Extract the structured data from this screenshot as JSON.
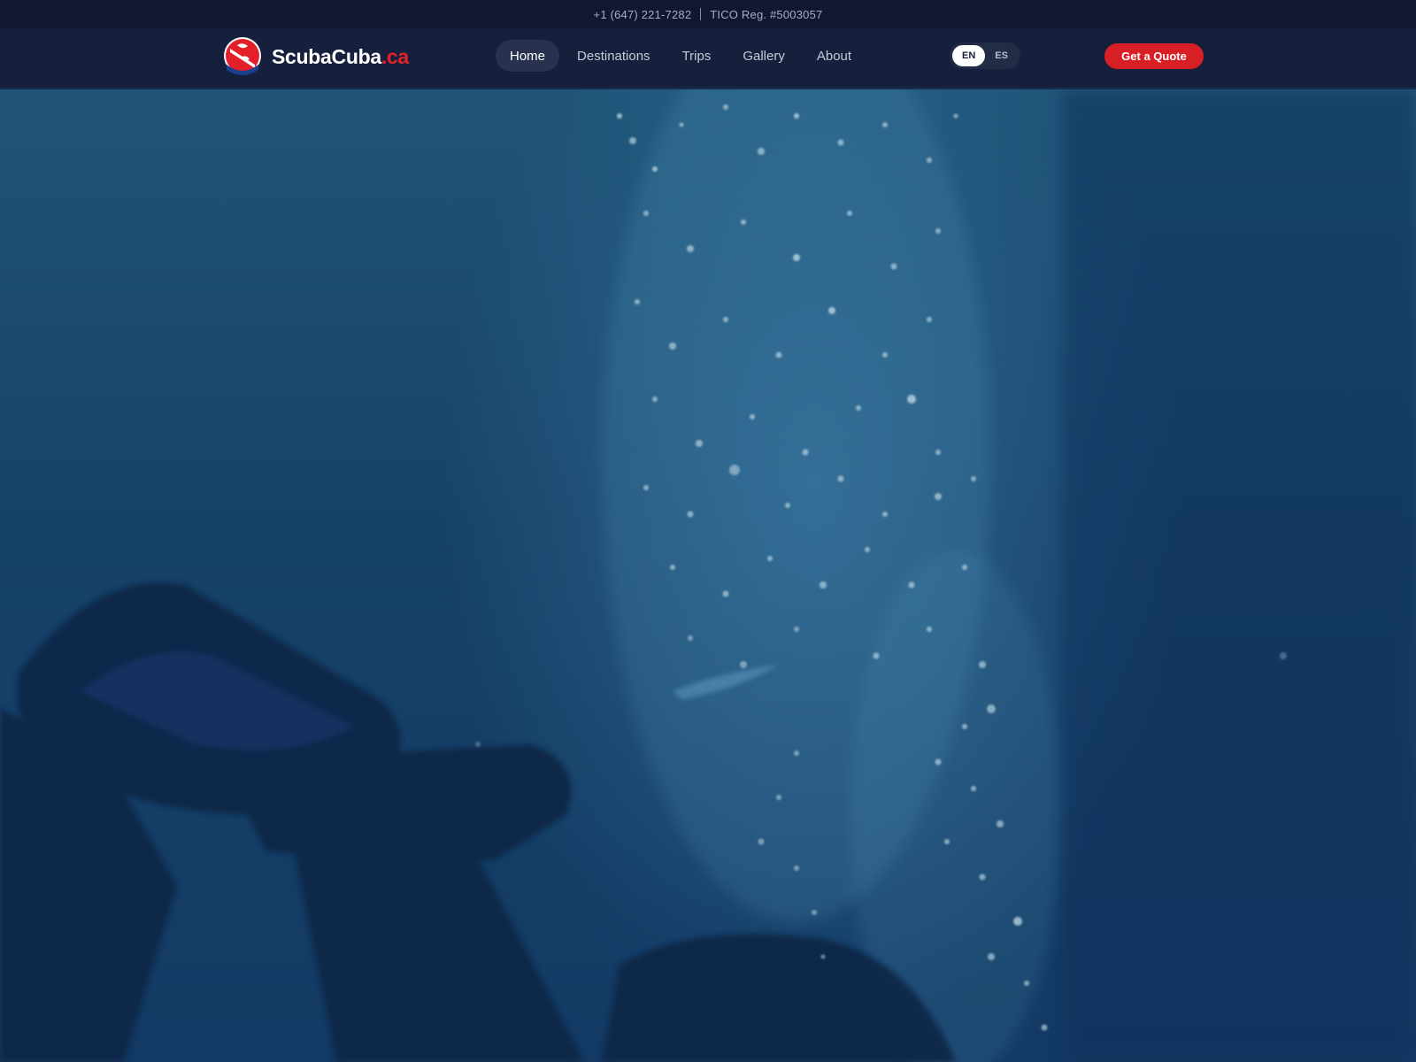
{
  "topbar": {
    "phone": "+1 (647) 221-7282",
    "registration": "TICO Reg. #5003057"
  },
  "brand": {
    "name": "ScubaCuba",
    "tld": ".ca",
    "accent_color": "#e3202a"
  },
  "nav": {
    "items": [
      {
        "label": "Home",
        "active": true
      },
      {
        "label": "Destinations",
        "active": false
      },
      {
        "label": "Trips",
        "active": false
      },
      {
        "label": "Gallery",
        "active": false
      },
      {
        "label": "About",
        "active": false
      }
    ]
  },
  "language": {
    "options": [
      "EN",
      "ES"
    ],
    "selected": "EN"
  },
  "cta": {
    "label": "Get a Quote",
    "color": "#d81f26"
  },
  "hero": {
    "image": "underwater-diver-fins-bubbles"
  }
}
